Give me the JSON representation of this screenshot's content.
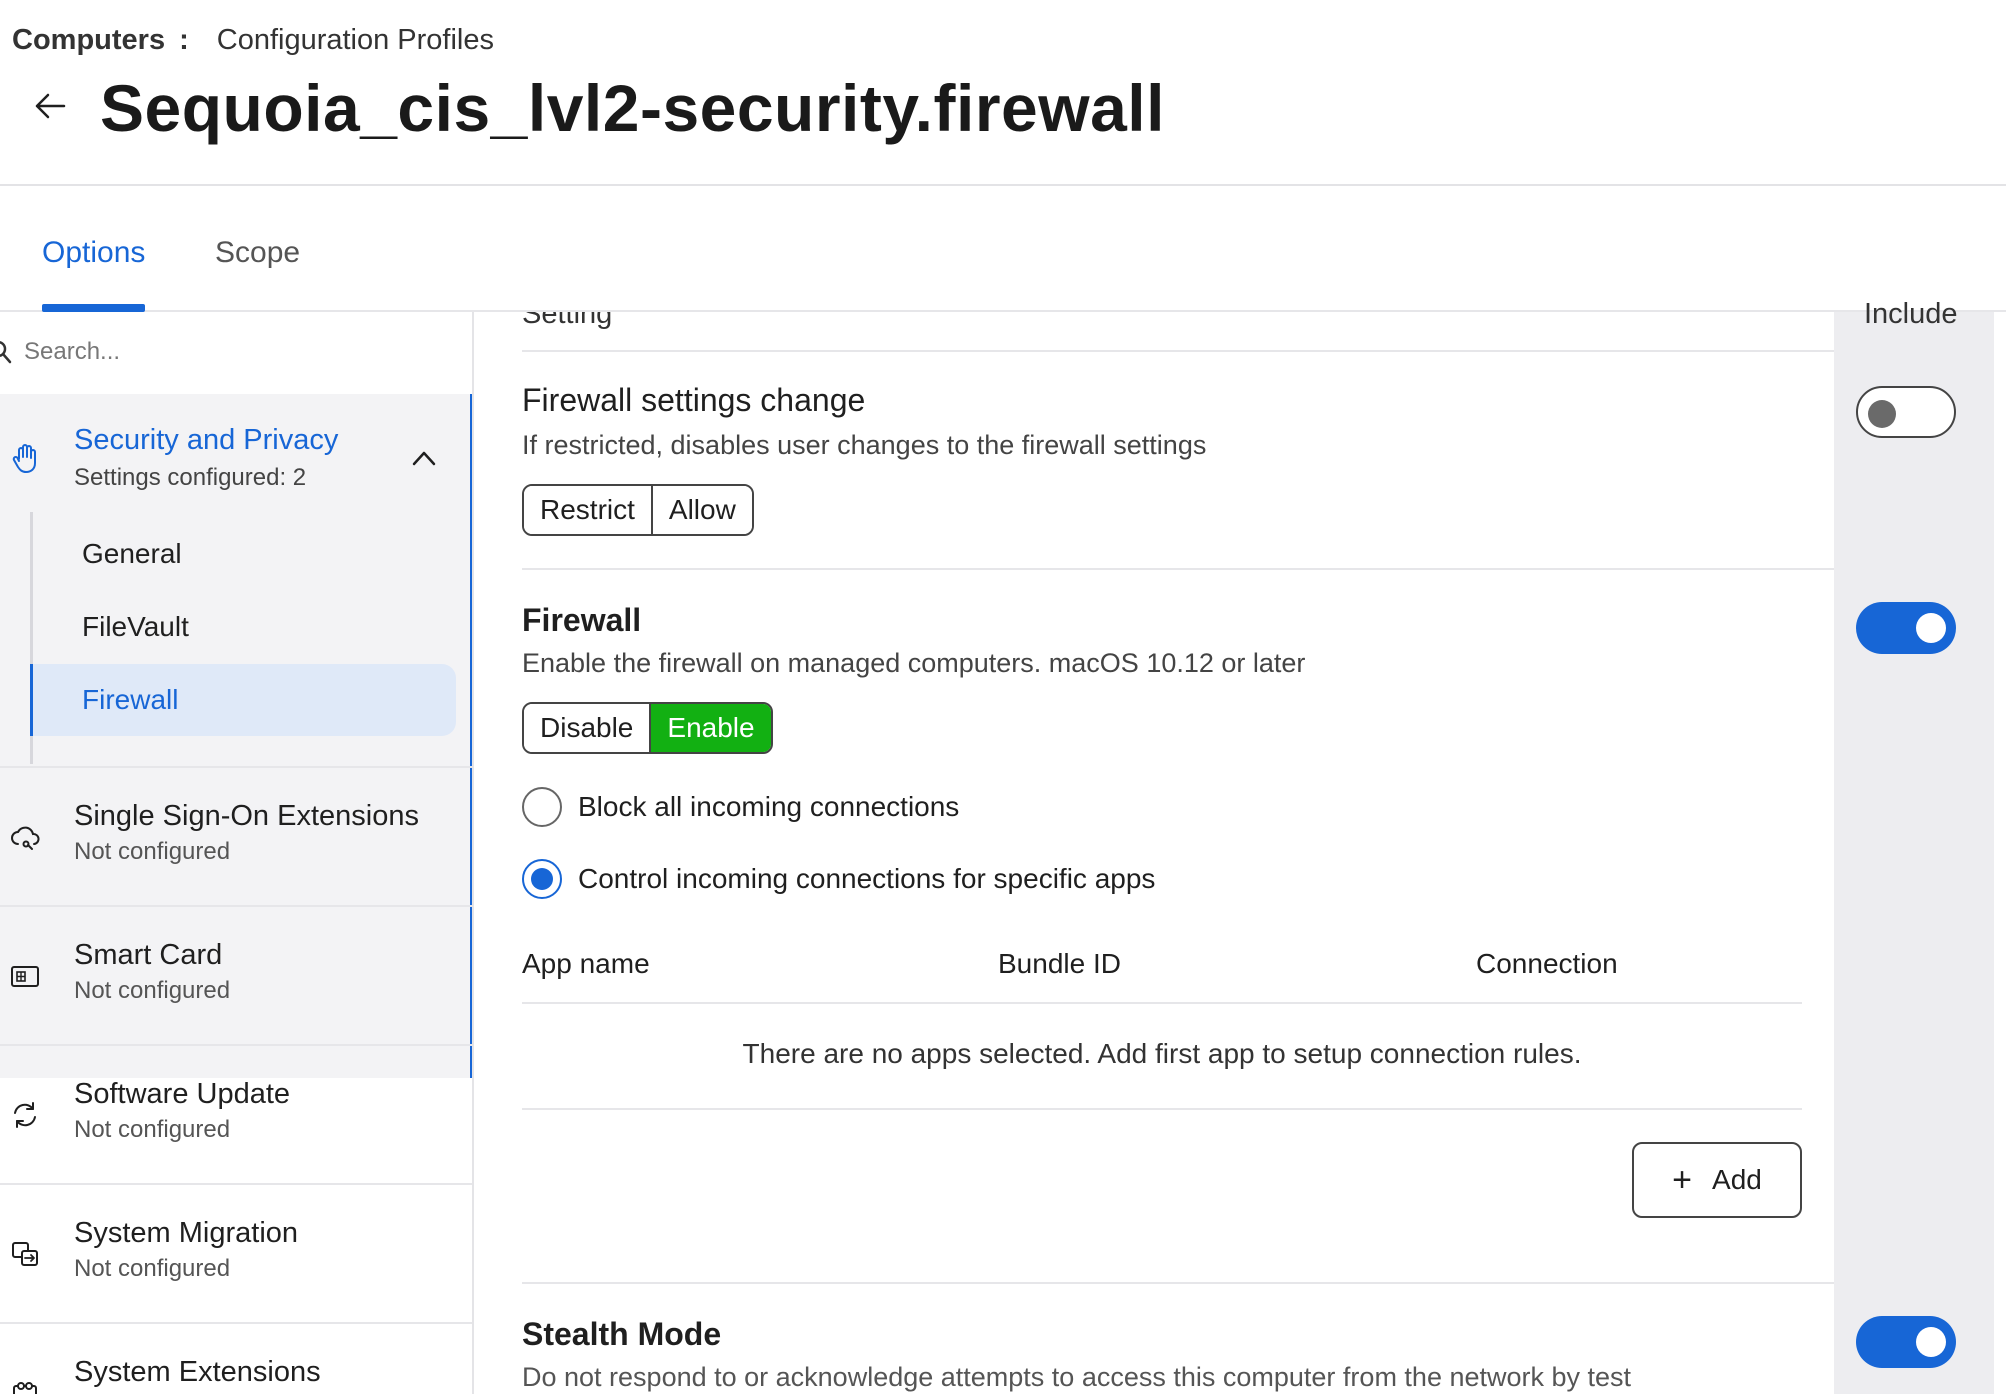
{
  "breadcrumb": {
    "root": "Computers",
    "separator": ":",
    "current": "Configuration Profiles"
  },
  "page_title": "Sequoia_cis_lvl2-security.firewall",
  "tabs": [
    {
      "label": "Options",
      "active": true
    },
    {
      "label": "Scope",
      "active": false
    }
  ],
  "search": {
    "placeholder": "Search..."
  },
  "sidebar": {
    "expanded_group": {
      "title": "Security and Privacy",
      "subtitle": "Settings configured: 2",
      "icon": "hand-icon",
      "items": [
        {
          "label": "General",
          "active": false
        },
        {
          "label": "FileVault",
          "active": false
        },
        {
          "label": "Firewall",
          "active": true
        }
      ]
    },
    "items": [
      {
        "title": "Single Sign-On Extensions",
        "subtitle": "Not configured",
        "icon": "cloud-key-icon"
      },
      {
        "title": "Smart Card",
        "subtitle": "Not configured",
        "icon": "smart-card-icon"
      },
      {
        "title": "Software Update",
        "subtitle": "Not configured",
        "icon": "refresh-icon"
      },
      {
        "title": "System Migration",
        "subtitle": "Not configured",
        "icon": "migration-icon"
      },
      {
        "title": "System Extensions",
        "subtitle": "",
        "icon": "extension-icon"
      }
    ]
  },
  "columns": {
    "setting": "Setting",
    "include": "Include"
  },
  "settings": {
    "firewall_settings_change": {
      "title": "Firewall settings change",
      "description": "If restricted, disables user changes to the firewall settings",
      "options": [
        "Restrict",
        "Allow"
      ],
      "selected": null,
      "included": false
    },
    "firewall": {
      "title": "Firewall",
      "description": "Enable the firewall on managed computers. macOS 10.12 or later",
      "options": [
        "Disable",
        "Enable"
      ],
      "selected": "Enable",
      "included": true,
      "radio_options": [
        {
          "label": "Block all incoming connections",
          "checked": false
        },
        {
          "label": "Control incoming connections for specific apps",
          "checked": true
        }
      ],
      "table": {
        "headers": [
          "App name",
          "Bundle ID",
          "Connection"
        ],
        "empty_message": "There are no apps selected. Add first app to setup connection rules."
      },
      "add_label": "Add"
    },
    "stealth_mode": {
      "title": "Stealth Mode",
      "description": "Do not respond to or acknowledge attempts to access this computer from the network by test",
      "included": true
    }
  },
  "colors": {
    "accent": "#1766d6",
    "enabled_green": "#12b012",
    "include_bg": "#ededf0"
  }
}
